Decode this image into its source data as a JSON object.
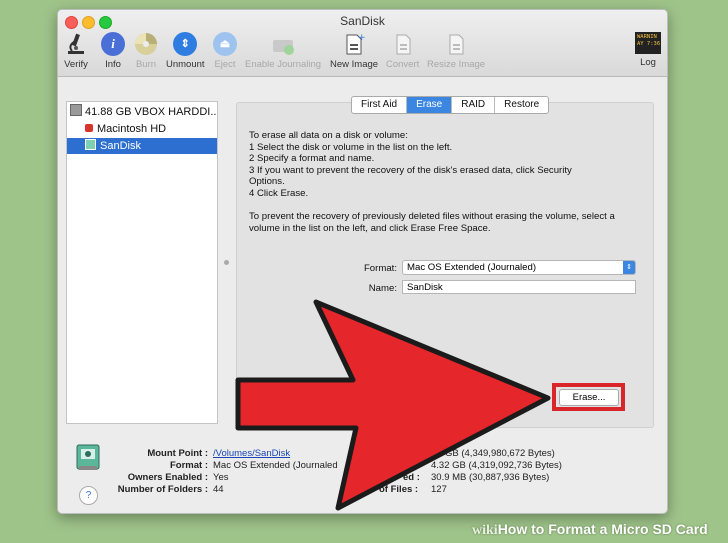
{
  "window": {
    "title": "SanDisk"
  },
  "toolbar": {
    "verify": "Verify",
    "info": "Info",
    "burn": "Burn",
    "unmount": "Unmount",
    "eject": "Eject",
    "enable_journaling": "Enable Journaling",
    "new_image": "New Image",
    "convert": "Convert",
    "resize_image": "Resize Image",
    "log": "Log",
    "log_icon_text": "WARNIN\nAY 7:36"
  },
  "sidebar": {
    "items": [
      {
        "label": "41.88 GB VBOX HARDDI..."
      },
      {
        "label": "Macintosh HD"
      },
      {
        "label": "SanDisk"
      }
    ]
  },
  "tabs": [
    "First Aid",
    "Erase",
    "RAID",
    "Restore"
  ],
  "erase": {
    "instructions": [
      "To erase all data on a disk or volume:",
      "1      Select the disk or volume in the list on the left.",
      "2      Specify a format and name.",
      "3      If you want to prevent the recovery of the disk's erased data, click Security",
      "Options.",
      "4      Click Erase."
    ],
    "free_space_note": [
      "To prevent the recovery of previously deleted files without erasing the volume, select a",
      "volume in the list on the left, and click Erase Free Space."
    ],
    "format_label": "Format:",
    "format_value": "Mac OS Extended (Journaled)",
    "name_label": "Name:",
    "name_value": "SanDisk",
    "erase_button": "Erase..."
  },
  "status": {
    "mount_point_label": "Mount Point :",
    "mount_point_value": "/Volumes/SanDisk",
    "format_label": "Format :",
    "format_value": "Mac OS Extended (Journaled",
    "owners_label": "Owners Enabled :",
    "owners_value": "Yes",
    "folders_label": "Number of Folders :",
    "folders_value": "44",
    "capacity_value": "GB (4,349,980,672 Bytes)",
    "available_value": "4.32 GB (4,319,092,736 Bytes)",
    "used_label": "ed :",
    "used_value": "30.9 MB (30,887,936 Bytes)",
    "files_label": "of Files :",
    "files_value": "127",
    "help": "?"
  },
  "watermark": {
    "wiki": "wiki",
    "rest": "How to Format a Micro SD Card"
  },
  "colors": {
    "arrow_red": "#e5262b",
    "selection_blue": "#2c6fd0",
    "tab_blue": "#3b86e0",
    "erase_outline": "#d8262b"
  }
}
